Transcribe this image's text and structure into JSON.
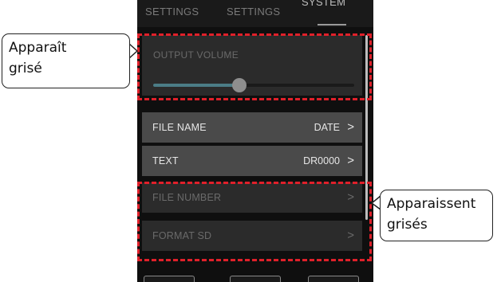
{
  "tabs": [
    {
      "label": "SETTINGS"
    },
    {
      "label": "SETTINGS"
    },
    {
      "label": "SYSTEM"
    }
  ],
  "output_volume": {
    "label": "OUTPUT VOLUME",
    "level_fraction": 0.43
  },
  "rows": [
    {
      "label": "FILE NAME",
      "value": "DATE",
      "icon": "chevron-right-icon",
      "dimmed": false
    },
    {
      "label": "TEXT",
      "value": "DR0000",
      "icon": "chevron-right-icon",
      "dimmed": false
    },
    {
      "label": "FILE NUMBER",
      "value": "",
      "icon": "chevron-right-icon",
      "dimmed": true
    },
    {
      "label": "FORMAT SD",
      "value": "",
      "icon": "chevron-right-icon",
      "dimmed": true
    }
  ],
  "callouts": {
    "left_line1": "Apparaît",
    "left_line2": "grisé",
    "right_line1": "Apparaissent",
    "right_line2": "grisés"
  },
  "colors": {
    "highlight_dash": "#e0202a",
    "slider_fill": "#4b7c86",
    "row_active": "#4a4a4a",
    "row_dimmed": "#2b2b2b"
  }
}
